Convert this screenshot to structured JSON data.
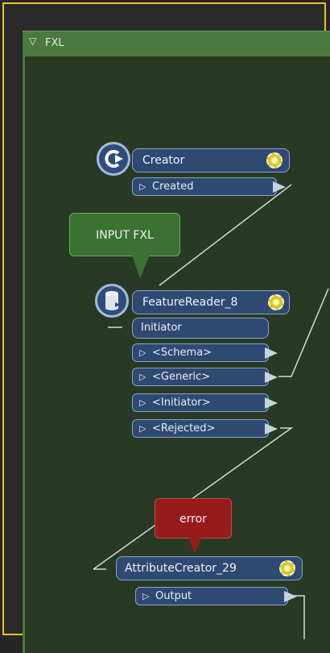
{
  "bookmark": {
    "collapse_icon": "triangle-down-icon",
    "title": "FXL"
  },
  "creator": {
    "title": "Creator",
    "icon": "creator-circle-arrow-icon",
    "ports": [
      {
        "label": "Created"
      }
    ]
  },
  "annotations": {
    "input_note": "INPUT FXL",
    "error_note": "error"
  },
  "feature_reader": {
    "title": "FeatureReader_8",
    "icon": "database-cylinder-icon",
    "input_port": "Initiator",
    "ports": [
      {
        "label": "<Schema>"
      },
      {
        "label": "<Generic>"
      },
      {
        "label": "<Initiator>"
      },
      {
        "label": "<Rejected>"
      }
    ]
  },
  "attribute_creator": {
    "title": "AttributeCreator_29",
    "ports": [
      {
        "label": "Output"
      }
    ]
  },
  "colors": {
    "frame_border": "#f0c21a",
    "bookmark": "#4a7a3b",
    "node": "#2e4a73",
    "callout_green": "#3a7232",
    "callout_red": "#961c1c"
  }
}
